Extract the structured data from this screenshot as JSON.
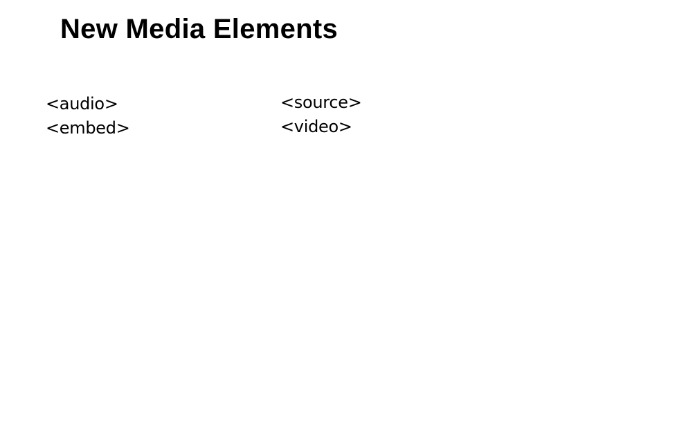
{
  "slide": {
    "title": "New Media Elements",
    "left_column": [
      "<audio>",
      "<embed>"
    ],
    "right_column": [
      "<source>",
      "<video>"
    ]
  }
}
